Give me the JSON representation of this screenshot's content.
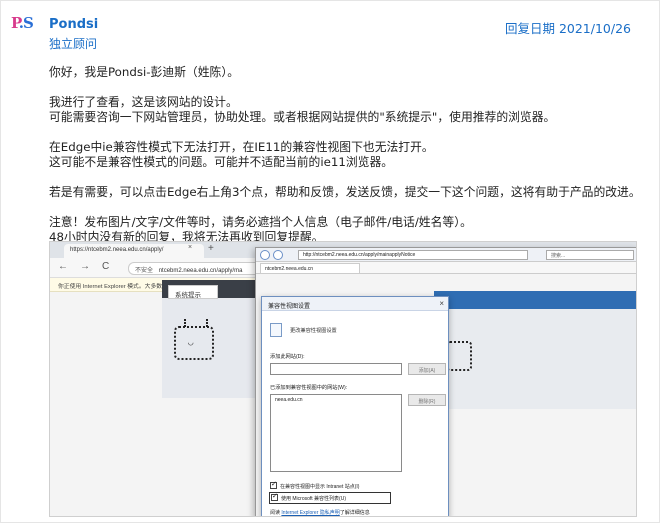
{
  "post": {
    "avatar_text": "P.S",
    "author_name": "Pondsi",
    "author_role": "独立顾问",
    "reply_date": "回复日期 2021/10/26",
    "paragraphs": [
      [
        "你好，我是Pondsi-彭迪斯（姓陈）。"
      ],
      [
        "我进行了查看，这是该网站的设计。",
        "可能需要咨询一下网站管理员，协助处理。或者根据网站提供的\"系统提示\"，使用推荐的浏览器。"
      ],
      [
        "在Edge中ie兼容性模式下无法打开，在IE11的兼容性视图下也无法打开。",
        "这可能不是兼容性模式的问题。可能并不适配当前的ie11浏览器。"
      ],
      [
        "若是有需要，可以点击Edge右上角3个点，帮助和反馈，发送反馈，提交一下这个问题，这将有助于产品的改进。"
      ],
      [
        "注意！发布图片/文字/文件等时，请务必遮挡个人信息（电子邮件/电话/姓名等）。",
        "48小时内没有新的回复，我将无法再收到回复提醒。"
      ]
    ]
  },
  "screenshot": {
    "edge": {
      "tab_title": "https://ntcebm2.neea.edu.cn/apply/",
      "tab_close": "×",
      "new_tab": "+",
      "nav_back": "←",
      "nav_forward": "→",
      "nav_refresh": "C",
      "url_warning": "不安全",
      "url": "ntcebm2.neea.edu.cn/apply/ma",
      "infobar": "你正使用 Internet Explorer 模式。大多数页面在 Microsoft Edge 中工作效果更佳。",
      "site_tab": "系统提示",
      "face": "◡"
    },
    "ie": {
      "url": "http://ntcebm2.neea.edu.cn/apply/mainapplyNotice",
      "search": "搜索...",
      "tab": "ntcebm2.neea.edu.cn",
      "blue_header": "示"
    },
    "dialog": {
      "title": "兼容性视图设置",
      "close": "×",
      "description": "更改兼容性视图设置",
      "add_label": "添加此网站(D):",
      "add_button": "添加(A)",
      "list_label": "已添加到兼容性视图中的网站(W):",
      "list_items": [
        "neea.edu.cn"
      ],
      "remove_button": "删除(R)",
      "check_intranet": "在兼容性视图中显示 Intranet 站点(I)",
      "check_ms_list": "使用 Microsoft 兼容性列表(U)",
      "footer_prefix": "阅读",
      "footer_link": "Internet Explorer 隐私声明",
      "footer_suffix": "了解详细信息"
    }
  }
}
